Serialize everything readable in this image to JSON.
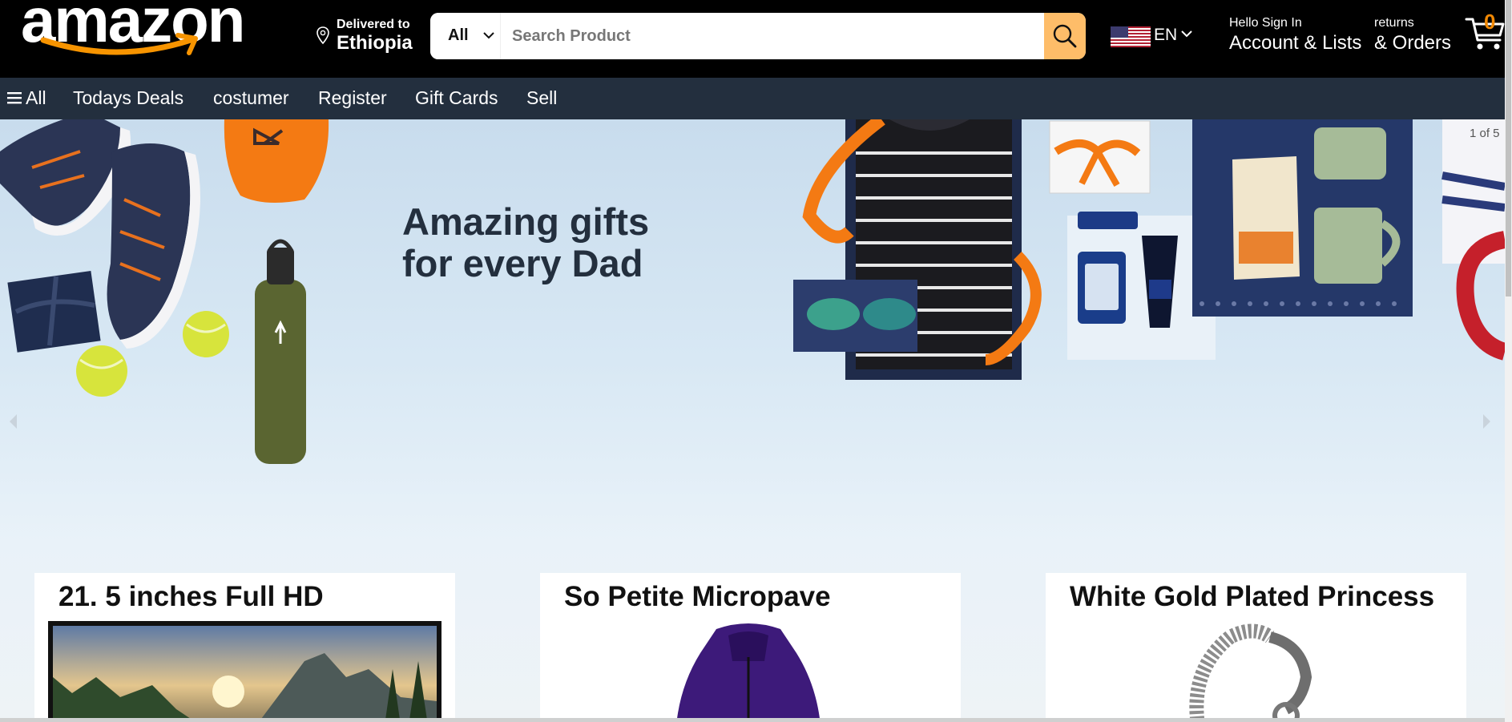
{
  "header": {
    "logo_text": "amazon",
    "deliver_label": "Delivered to",
    "deliver_location": "Ethiopia",
    "search": {
      "category": "All",
      "placeholder": "Search Product"
    },
    "language": "EN",
    "account_greeting": "Hello Sign In",
    "account_label": "Account & Lists",
    "returns_label": "returns",
    "orders_label": "& Orders",
    "cart_count": "0"
  },
  "nav": {
    "all_label": "All",
    "items": [
      "Todays Deals",
      "costumer",
      "Register",
      "Gift Cards",
      "Sell"
    ]
  },
  "hero": {
    "title_line1": "Amazing gifts",
    "title_line2": "for every Dad",
    "counter": "1 of 5"
  },
  "cards": [
    {
      "title": "21. 5 inches Full HD"
    },
    {
      "title": "So Petite Micropave"
    },
    {
      "title": "White Gold Plated Princess"
    }
  ],
  "colors": {
    "header_bg": "#000000",
    "nav_bg": "#232f3e",
    "search_button": "#febd69",
    "accent_orange": "#f08804"
  }
}
